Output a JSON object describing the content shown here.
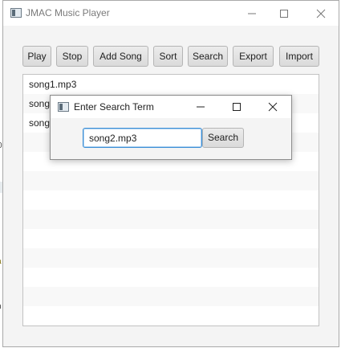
{
  "window": {
    "title": "JMAC Music Player"
  },
  "toolbar": {
    "buttons": [
      "Play",
      "Stop",
      "Add Song",
      "Sort",
      "Search",
      "Export",
      "Import"
    ]
  },
  "playlist": {
    "items": [
      "song1.mp3",
      "song",
      "song"
    ]
  },
  "dialog": {
    "title": "Enter Search Term",
    "search_value": "song2.mp3",
    "search_button": "Search"
  },
  "desktop": {
    "edge_labels": [
      "0",
      "a",
      "n"
    ]
  }
}
